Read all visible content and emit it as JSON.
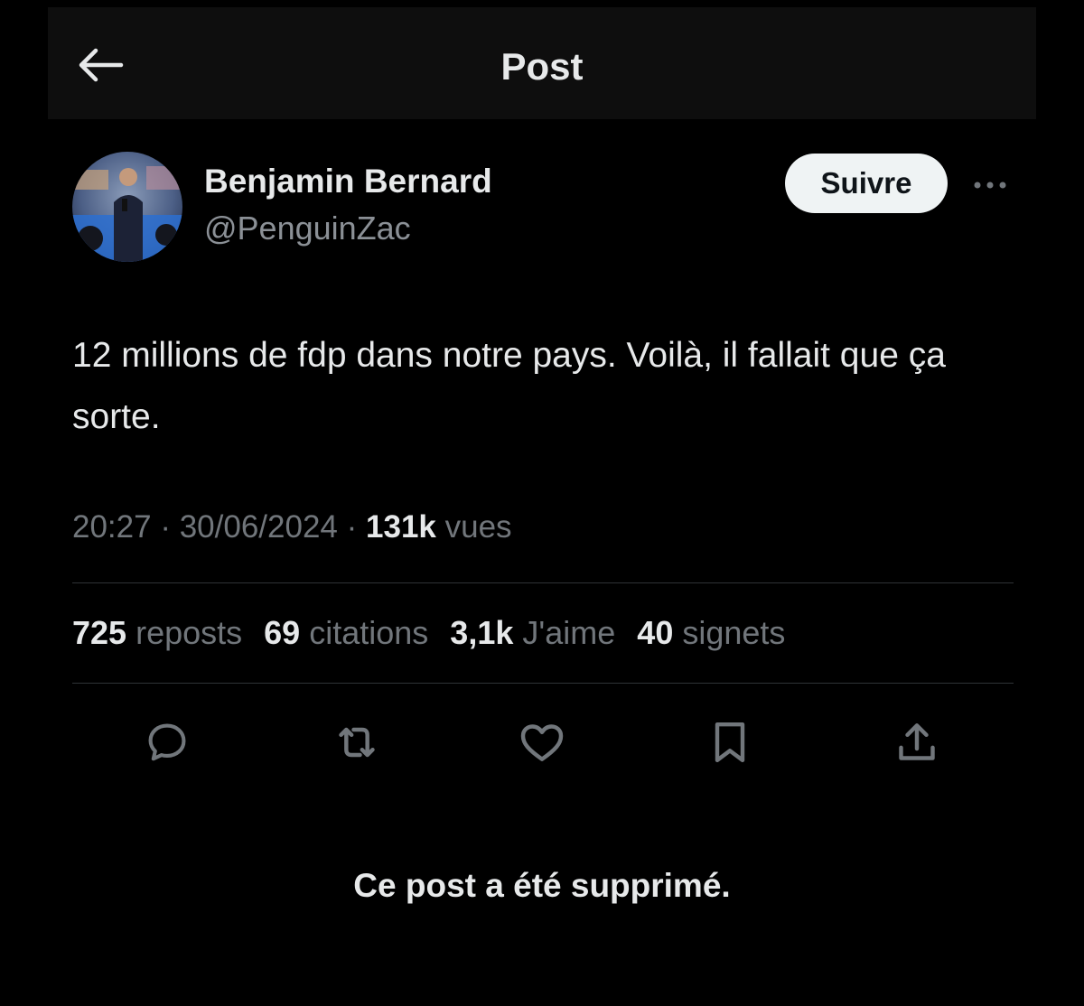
{
  "header": {
    "back_icon": "arrow-left-icon",
    "title": "Post"
  },
  "author": {
    "name": "Benjamin Bernard",
    "handle": "@PenguinZac",
    "follow_label": "Suivre",
    "more_icon": "more-dots-icon"
  },
  "post": {
    "text": "12 millions de fdp dans notre pays. Voilà, il fallait que ça sorte.",
    "time": "20:27",
    "separator": "·",
    "date": "30/06/2024",
    "views_count": "131k",
    "views_label": "vues"
  },
  "stats": {
    "reposts_count": "725",
    "reposts_label": "reposts",
    "quotes_count": "69",
    "quotes_label": "citations",
    "likes_count": "3,1k",
    "likes_label": "J'aime",
    "bookmarks_count": "40",
    "bookmarks_label": "signets"
  },
  "actions": [
    {
      "icon": "reply-icon"
    },
    {
      "icon": "repost-icon"
    },
    {
      "icon": "heart-icon"
    },
    {
      "icon": "bookmark-icon"
    },
    {
      "icon": "share-icon"
    }
  ],
  "deleted_note": "Ce post a été supprimé.",
  "colors": {
    "background": "#000000",
    "text_primary": "#e7e9ea",
    "text_secondary": "#71767b",
    "divider": "#2f3336",
    "follow_button_bg": "#eff3f4"
  }
}
